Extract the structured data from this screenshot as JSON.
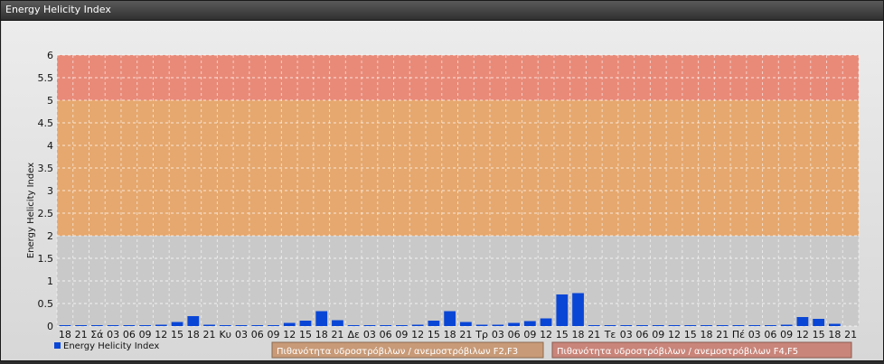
{
  "window": {
    "title": "Energy Helicity Index"
  },
  "chart_data": {
    "type": "bar",
    "ylabel": "Energy Helicity Index",
    "ylim": [
      0,
      6
    ],
    "yticks": [
      "0",
      "0.5",
      "1",
      "1.5",
      "2",
      "2.5",
      "3",
      "3.5",
      "4",
      "4.5",
      "5",
      "5.5",
      "6"
    ],
    "bands": [
      {
        "from": 0,
        "to": 2,
        "color": "#c9c9c9"
      },
      {
        "from": 2,
        "to": 5,
        "color": "#e6a86e"
      },
      {
        "from": 5,
        "to": 6,
        "color": "#e98a78"
      }
    ],
    "categories": [
      "18",
      "21",
      "Σά",
      "03",
      "06",
      "09",
      "12",
      "15",
      "18",
      "21",
      "Κυ",
      "03",
      "06",
      "09",
      "12",
      "15",
      "18",
      "21",
      "Δε",
      "03",
      "06",
      "09",
      "12",
      "15",
      "18",
      "21",
      "Τρ",
      "03",
      "06",
      "09",
      "12",
      "15",
      "18",
      "21",
      "Τε",
      "03",
      "06",
      "09",
      "12",
      "15",
      "18",
      "21",
      "Πέ",
      "03",
      "06",
      "09",
      "12",
      "15",
      "18",
      "21"
    ],
    "series": [
      {
        "name": "Energy Helicity Index",
        "color": "#0a46d6",
        "values": [
          0.02,
          0.02,
          0.02,
          0.02,
          0.02,
          0.02,
          0.03,
          0.09,
          0.22,
          0.03,
          0.02,
          0.02,
          0.02,
          0.02,
          0.07,
          0.12,
          0.33,
          0.13,
          0.02,
          0.02,
          0.02,
          0.02,
          0.03,
          0.12,
          0.33,
          0.09,
          0.03,
          0.03,
          0.07,
          0.11,
          0.17,
          0.7,
          0.73,
          0.02,
          0.02,
          0.02,
          0.02,
          0.02,
          0.02,
          0.02,
          0.02,
          0.02,
          0.02,
          0.02,
          0.02,
          0.03,
          0.2,
          0.16,
          0.05
        ]
      }
    ],
    "legend": {
      "series_label": "Energy Helicity Index",
      "band_labels": [
        {
          "label": "Πιθανότητα υδροστρόβιλων / ανεμοστρόβιλων F2,F3",
          "color": "#c89a77"
        },
        {
          "label": "Πιθανότητα υδροστρόβιλων / ανεμοστρόβιλων F4,F5",
          "color": "#c9857a"
        }
      ]
    }
  }
}
